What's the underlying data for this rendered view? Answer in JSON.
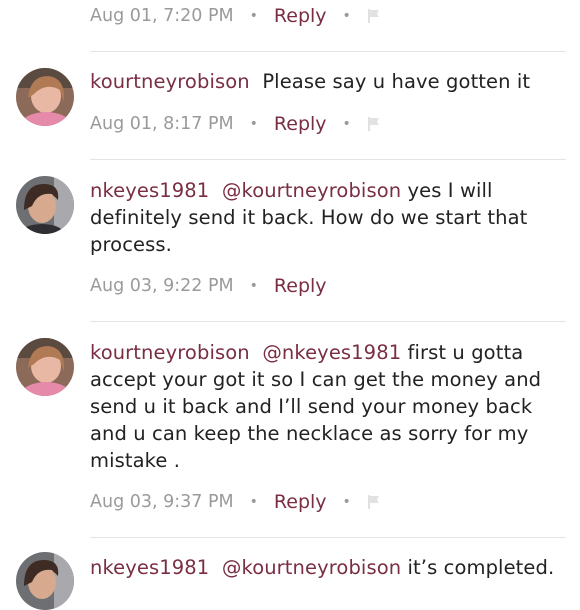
{
  "comments": [
    {
      "time": "Aug 01, 7:20 PM",
      "reply": "Reply",
      "has_flag": true
    },
    {
      "user": "kourtneyrobison",
      "mention": "",
      "text": "Please say u have gotten it",
      "time": "Aug 01, 8:17 PM",
      "reply": "Reply",
      "has_flag": true
    },
    {
      "user": "nkeyes1981",
      "mention": "@kourtneyrobison",
      "text": "yes I will definitely send it back. How do we start that process.",
      "time": "Aug 03, 9:22 PM",
      "reply": "Reply",
      "has_flag": false
    },
    {
      "user": "kourtneyrobison",
      "mention": "@nkeyes1981",
      "text": "first u gotta accept your got it so I can get the money and send u it back and I’ll send your money back and u can keep the necklace as sorry for my mistake .",
      "time": "Aug 03, 9:37 PM",
      "reply": "Reply",
      "has_flag": true
    },
    {
      "user": "nkeyes1981",
      "mention": "@kourtneyrobison",
      "text": "it’s completed."
    }
  ],
  "icons": {
    "flag": "flag-icon",
    "separator": "bullet-dot"
  },
  "colors": {
    "username": "#7a2e43",
    "reply": "#7a2e43",
    "meta": "#9a9a9a",
    "divider": "#e4e4e4"
  }
}
